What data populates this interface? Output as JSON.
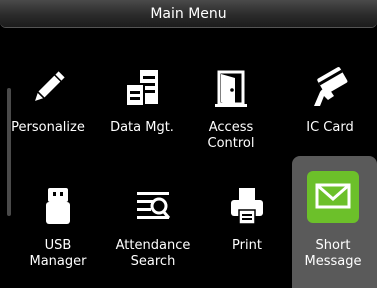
{
  "header": {
    "title": "Main Menu"
  },
  "menu": {
    "items": [
      {
        "label": "Personalize",
        "icon": "pencil-icon"
      },
      {
        "label": "Data Mgt.",
        "icon": "server-icon"
      },
      {
        "label": "Access\nControl",
        "icon": "door-icon"
      },
      {
        "label": "IC Card",
        "icon": "card-hand-icon"
      },
      {
        "label": "USB\nManager",
        "icon": "usb-drive-icon"
      },
      {
        "label": "Attendance\nSearch",
        "icon": "search-records-icon"
      },
      {
        "label": "Print",
        "icon": "printer-icon"
      },
      {
        "label": "Short\nMessage",
        "icon": "envelope-icon",
        "selected": true
      }
    ]
  },
  "colors": {
    "selected_icon_bg": "#6cc02a",
    "selected_tile_bg": "#5a5a5a"
  }
}
